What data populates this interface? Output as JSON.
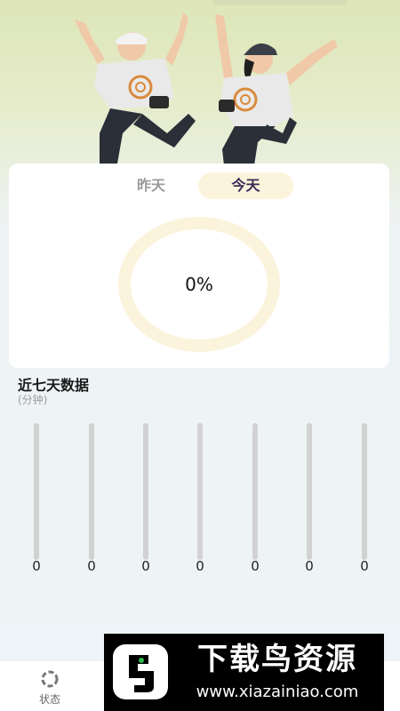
{
  "header": {
    "illustration": "two-people-jumping"
  },
  "tabs": [
    {
      "label": "昨天",
      "active": false
    },
    {
      "label": "今天",
      "active": true
    }
  ],
  "progress": {
    "value_text": "0%",
    "value": 0
  },
  "weekly": {
    "title": "近七天数据",
    "unit": "(分钟)",
    "values": [
      0,
      0,
      0,
      0,
      0,
      0,
      0
    ],
    "max": 60
  },
  "bottom_nav": {
    "items": [
      {
        "label": "状态",
        "icon": "status-icon"
      }
    ]
  },
  "watermark": {
    "title": "下载鸟资源",
    "url": "www.xiazainiao.com"
  },
  "colors": {
    "ring": "#fbf3dc",
    "active_tab_bg": "#fbf3dc",
    "active_tab_text": "#3a2a55",
    "bar_track": "#d2d2d2"
  }
}
